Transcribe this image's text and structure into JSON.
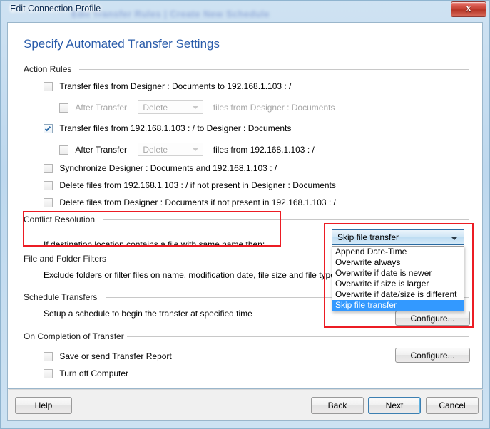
{
  "window": {
    "title": "Edit Connection Profile",
    "ghost_text": "Edit Transfer Rules  |  Create New Schedule",
    "close_label": "X"
  },
  "page": {
    "title": "Specify Automated Transfer Settings"
  },
  "groups": {
    "action_rules": "Action Rules",
    "conflict_resolution": "Conflict Resolution",
    "file_and_folder_filters": "File and Folder Filters",
    "schedule_transfers": "Schedule Transfers",
    "on_completion": "On Completion of Transfer"
  },
  "action_rules": {
    "rule1": {
      "label": "Transfer files from Designer : Documents to 192.168.1.103 : /",
      "checked": false
    },
    "rule1_after": {
      "label": "After Transfer",
      "checked": false,
      "combo_value": "Delete",
      "suffix": "files from Designer : Documents",
      "enabled": false
    },
    "rule2": {
      "label": "Transfer files from 192.168.1.103 : / to Designer : Documents",
      "checked": true
    },
    "rule2_after": {
      "label": "After Transfer",
      "checked": false,
      "combo_value": "Delete",
      "suffix": "files from 192.168.1.103 : /",
      "enabled": false
    },
    "rule3": {
      "label": "Synchronize Designer : Documents and 192.168.1.103 : /",
      "checked": false
    },
    "rule4": {
      "label": "Delete files from 192.168.1.103 : / if not present in Designer : Documents",
      "checked": false
    },
    "rule5": {
      "label": "Delete files from Designer : Documents if not present in 192.168.1.103 : /",
      "checked": false
    }
  },
  "conflict_resolution": {
    "prompt": "If destination location contains a file with same name then:",
    "selected": "Skip file transfer",
    "options": [
      "Append Date-Time",
      "Overwrite always",
      "Overwrite if date is newer",
      "Overwrite if size is larger",
      "Overwrite if date/size is different",
      "Skip file transfer"
    ],
    "configure_label": "Configure..."
  },
  "file_and_folder_filters": {
    "description": "Exclude folders or filter files on name, modification date, file size and file type"
  },
  "schedule_transfers": {
    "description": "Setup a schedule to begin the transfer at specified time",
    "configure_label": "Configure..."
  },
  "on_completion": {
    "report": {
      "label": "Save or send Transfer Report",
      "checked": false
    },
    "shutdown": {
      "label": "Turn off Computer",
      "checked": false
    }
  },
  "footer": {
    "help": "Help",
    "back": "Back",
    "next": "Next",
    "cancel": "Cancel"
  },
  "colors": {
    "accent_blue": "#2a5caa",
    "highlight": "#3399ff",
    "annotation_red": "#ec1c24",
    "close_red": "#c03a2c"
  }
}
